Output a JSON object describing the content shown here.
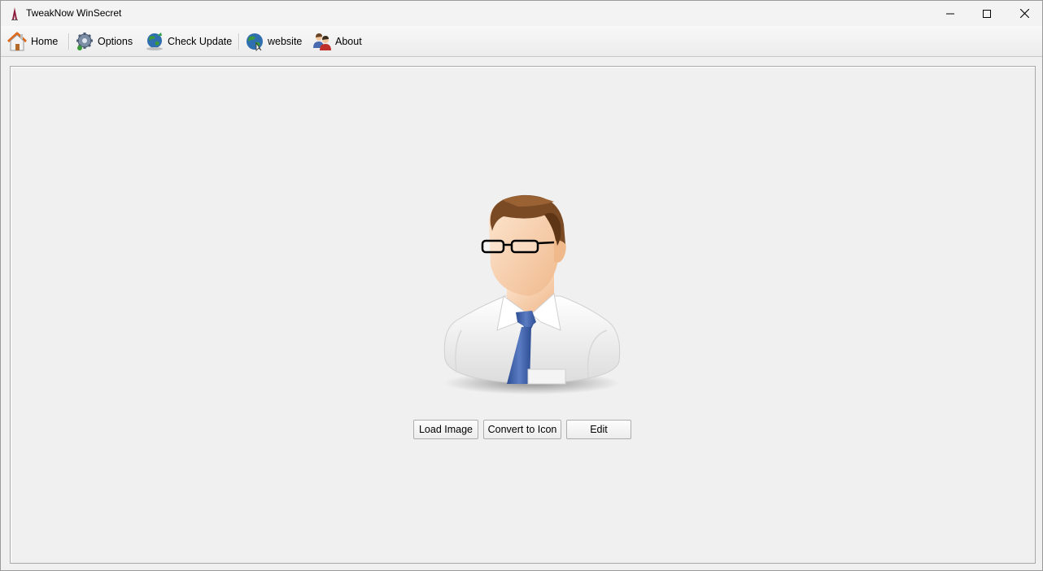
{
  "window": {
    "title": "TweakNow WinSecret",
    "app_icon": "app-logo-icon",
    "controls": [
      "minimize-icon",
      "maximize-icon",
      "close-icon"
    ]
  },
  "toolbar": {
    "items": [
      {
        "label": "Home",
        "icon": "home-icon"
      },
      {
        "label": "Options",
        "icon": "gear-icon"
      },
      {
        "label": "Check Update",
        "icon": "globe-update-icon"
      },
      {
        "label": "website",
        "icon": "globe-icon"
      },
      {
        "label": "About",
        "icon": "users-icon"
      }
    ]
  },
  "main": {
    "image_icon": "user-avatar-icon",
    "buttons": {
      "load_label": "Load Image",
      "convert_label": "Convert to Icon",
      "edit_label": "Edit"
    }
  },
  "colors": {
    "background": "#f0f0f0",
    "home_roof": "#e06a1a",
    "globe_blue": "#2f6fb0",
    "globe_green": "#3a9a3a",
    "tie_blue": "#3b5ea8",
    "hair_brown": "#7a4a24"
  }
}
